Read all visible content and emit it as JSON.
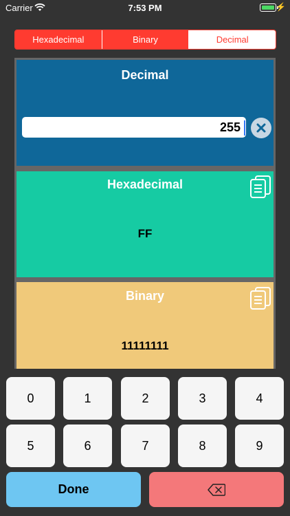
{
  "status_bar": {
    "carrier": "Carrier",
    "time": "7:53 PM"
  },
  "tabs": [
    {
      "label": "Hexadecimal",
      "selected": false
    },
    {
      "label": "Binary",
      "selected": false
    },
    {
      "label": "Decimal",
      "selected": true
    }
  ],
  "decimal_panel": {
    "title": "Decimal",
    "value": "255"
  },
  "hex_panel": {
    "title": "Hexadecimal",
    "value": "FF"
  },
  "binary_panel": {
    "title": "Binary",
    "value": "11111111"
  },
  "keypad": {
    "keys": [
      "0",
      "1",
      "2",
      "3",
      "4",
      "5",
      "6",
      "7",
      "8",
      "9"
    ],
    "done_label": "Done",
    "delete_icon": "backspace-icon"
  },
  "colors": {
    "accent": "#ff3b30",
    "decimal_bg": "#0f6799",
    "hex_bg": "#16cba3",
    "binary_bg": "#f0c97a",
    "done_bg": "#6ec6f2",
    "delete_bg": "#f4787a"
  }
}
